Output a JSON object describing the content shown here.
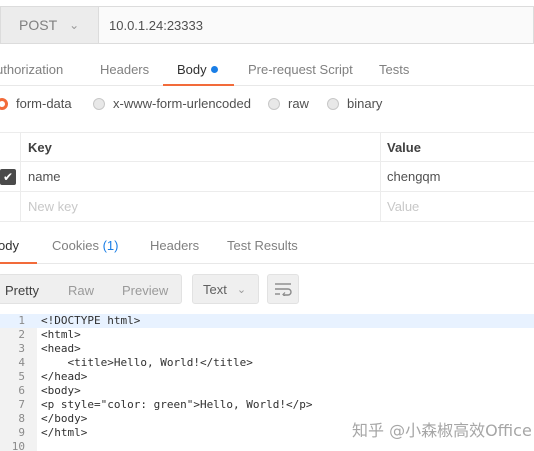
{
  "request": {
    "method": "POST",
    "url": "10.0.1.24:23333"
  },
  "request_tabs": [
    {
      "label": "uthorization"
    },
    {
      "label": "Headers"
    },
    {
      "label": "Body"
    },
    {
      "label": "Pre-request Script"
    },
    {
      "label": "Tests"
    }
  ],
  "body_modes": [
    {
      "label": "form-data",
      "selected": true
    },
    {
      "label": "x-www-form-urlencoded",
      "selected": false
    },
    {
      "label": "raw",
      "selected": false
    },
    {
      "label": "binary",
      "selected": false
    }
  ],
  "kv_table": {
    "headers": {
      "key": "Key",
      "value": "Value"
    },
    "rows": [
      {
        "key": "name",
        "value": "chengqm",
        "checked": true
      }
    ],
    "new_row": {
      "key_placeholder": "New key",
      "value_placeholder": "Value"
    }
  },
  "response_tabs": [
    {
      "label": "ody"
    },
    {
      "label": "Cookies",
      "count": "(1)"
    },
    {
      "label": "Headers"
    },
    {
      "label": "Test Results"
    }
  ],
  "view_modes": [
    "Pretty",
    "Raw",
    "Preview"
  ],
  "format_select": "Text",
  "code_lines": [
    {
      "n": "1",
      "text": "<!DOCTYPE html>"
    },
    {
      "n": "2",
      "text": "<html>"
    },
    {
      "n": "3",
      "text": "<head>"
    },
    {
      "n": "4",
      "text": "    <title>Hello, World!</title>"
    },
    {
      "n": "5",
      "text": "</head>"
    },
    {
      "n": "6",
      "text": "<body>"
    },
    {
      "n": "7",
      "text": "<p style=\"color: green\">Hello, World!</p>"
    },
    {
      "n": "8",
      "text": "</body>"
    },
    {
      "n": "9",
      "text": "</html>"
    },
    {
      "n": "10",
      "text": ""
    }
  ],
  "watermark": "知乎 @小森椒高效Office",
  "colors": {
    "accent": "#f26b3a",
    "link_blue": "#1a7ee6"
  }
}
